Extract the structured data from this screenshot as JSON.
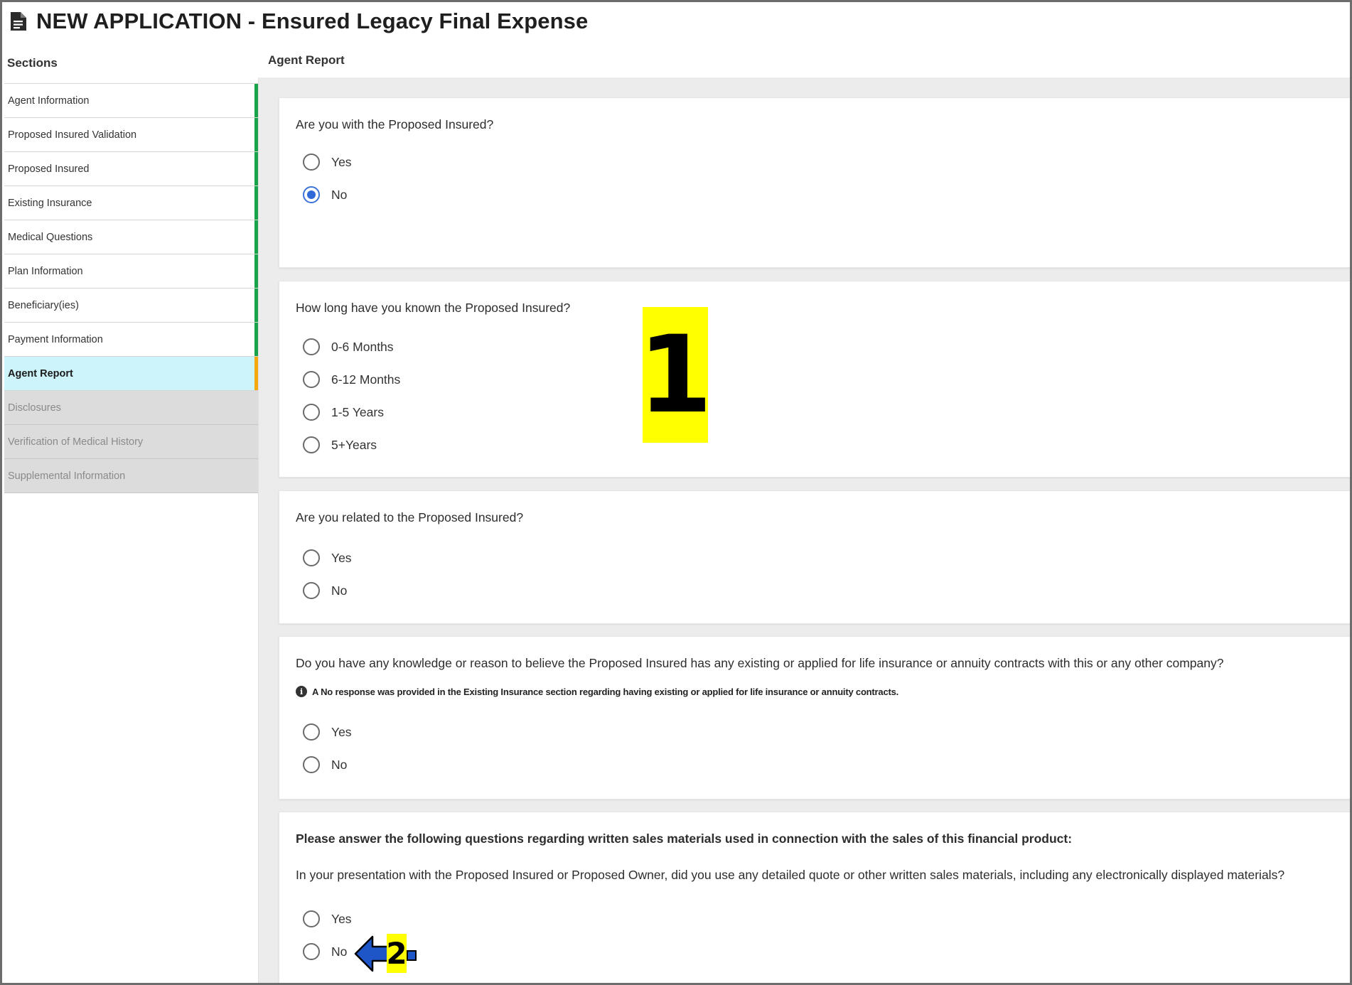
{
  "window": {
    "title": "NEW APPLICATION - Ensured Legacy Final Expense",
    "title_icon": "document-icon"
  },
  "sidebar": {
    "header": "Sections",
    "items": [
      {
        "label": "Agent Information",
        "state": "complete"
      },
      {
        "label": "Proposed Insured Validation",
        "state": "complete"
      },
      {
        "label": "Proposed Insured",
        "state": "complete"
      },
      {
        "label": "Existing Insurance",
        "state": "complete"
      },
      {
        "label": "Medical Questions",
        "state": "complete"
      },
      {
        "label": "Plan Information",
        "state": "complete"
      },
      {
        "label": "Beneficiary(ies)",
        "state": "complete"
      },
      {
        "label": "Payment Information",
        "state": "complete"
      },
      {
        "label": "Agent Report",
        "state": "active"
      },
      {
        "label": "Disclosures",
        "state": "locked"
      },
      {
        "label": "Verification of Medical History",
        "state": "locked"
      },
      {
        "label": "Supplemental Information",
        "state": "locked"
      }
    ],
    "colors": {
      "complete": "#17a34a",
      "active": "#f4a90f",
      "active_bg": "#cdf3fb",
      "locked_bg": "#dcdcdc"
    }
  },
  "main": {
    "header": "Agent Report",
    "questions": [
      {
        "text": "Are you with the Proposed Insured?",
        "options": [
          "Yes",
          "No"
        ],
        "selected": "No"
      },
      {
        "text": "How long have you known the Proposed Insured?",
        "options": [
          "0-6 Months",
          "6-12 Months",
          "1-5 Years",
          "5+Years"
        ],
        "selected": null
      },
      {
        "text": "Are you related to the Proposed Insured?",
        "options": [
          "Yes",
          "No"
        ],
        "selected": null
      },
      {
        "text": "Do you have any knowledge or reason to believe the Proposed Insured has any existing or applied for life insurance or annuity contracts with this or any other company?",
        "note": "A No response was provided in the Existing Insurance section regarding having existing or applied for life insurance or annuity contracts.",
        "note_icon": "info-icon",
        "options": [
          "Yes",
          "No"
        ],
        "selected": null
      },
      {
        "heading": "Please answer the following questions regarding written sales materials used in connection with the sales of this financial product:",
        "text": "In your presentation with the Proposed Insured or Proposed Owner, did you use any detailed quote or other written sales materials, including any electronically displayed materials?",
        "options": [
          "Yes",
          "No"
        ],
        "selected": null
      }
    ],
    "accent_color": "#2f6ad8"
  },
  "annotations": {
    "marker_1": "1",
    "marker_2": "2",
    "marker_color": "#ffff00",
    "arrow_color": "#1e56c8"
  }
}
